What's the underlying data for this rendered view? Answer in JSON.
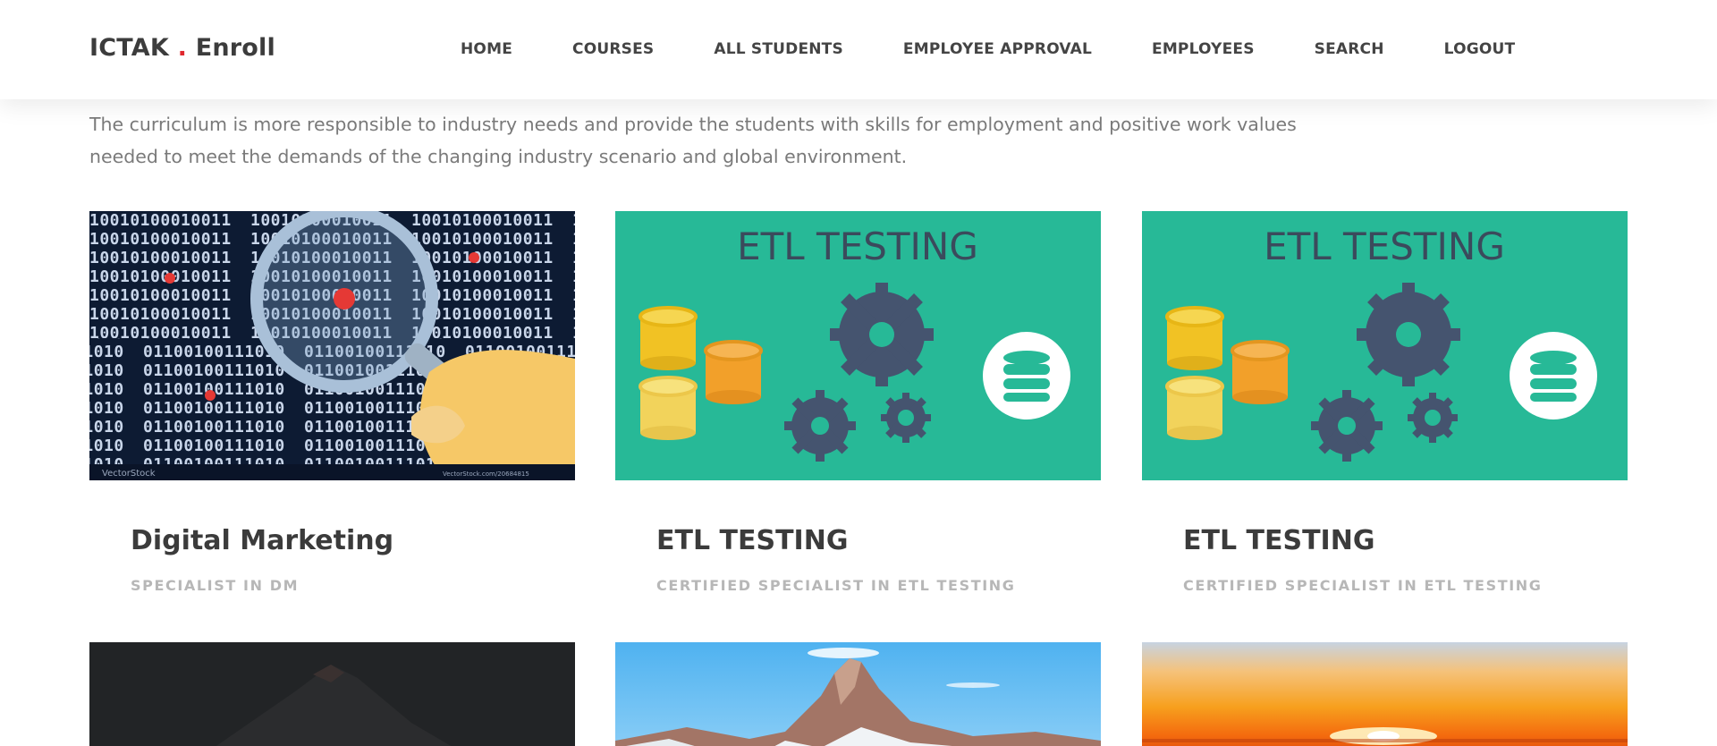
{
  "brand": {
    "name": "ICTAK",
    "separator": ".",
    "suffix": "Enroll"
  },
  "nav": {
    "items": [
      {
        "label": "HOME"
      },
      {
        "label": "COURSES"
      },
      {
        "label": "ALL STUDENTS"
      },
      {
        "label": "EMPLOYEE APPROVAL"
      },
      {
        "label": "EMPLOYEES"
      },
      {
        "label": "SEARCH"
      },
      {
        "label": "LOGOUT"
      }
    ]
  },
  "intro": {
    "line1": "The curriculum is more responsible to industry needs and provide the students with skills for employment and positive work values",
    "line2": "needed to meet the demands of the changing industry scenario and global environment."
  },
  "courses": [
    {
      "title": "Digital Marketing",
      "subtitle": "SPECIALIST IN DM",
      "image_caption": "VectorStock",
      "image_url_caption": "VectorStock.com/20684815"
    },
    {
      "title": "ETL TESTING",
      "subtitle": "CERTIFIED SPECIALIST IN ETL TESTING",
      "image_caption": "ETL TESTING"
    },
    {
      "title": "ETL TESTING",
      "subtitle": "CERTIFIED SPECIALIST IN ETL TESTING",
      "image_caption": "ETL TESTING"
    }
  ],
  "colors": {
    "brand_dot": "#e0282e",
    "etl_background": "#27b997",
    "gear": "#45546f",
    "binary_background": "#0d1b33"
  }
}
